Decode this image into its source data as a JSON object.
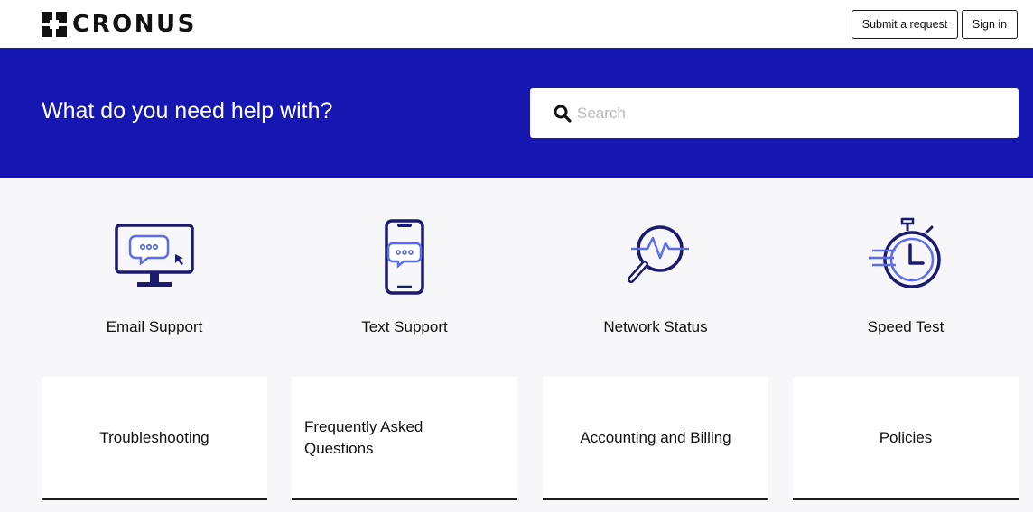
{
  "header": {
    "logo_text": "CRONUS",
    "submit_label": "Submit a request",
    "signin_label": "Sign in"
  },
  "hero": {
    "title": "What do you need help with?",
    "search_placeholder": "Search"
  },
  "tiles": [
    {
      "label": "Email Support",
      "icon": "monitor-chat-icon"
    },
    {
      "label": "Text Support",
      "icon": "phone-chat-icon"
    },
    {
      "label": "Network Status",
      "icon": "magnifier-pulse-icon"
    },
    {
      "label": "Speed Test",
      "icon": "stopwatch-icon"
    }
  ],
  "cards": [
    {
      "label": "Troubleshooting"
    },
    {
      "label": "Frequently Asked Questions"
    },
    {
      "label": "Accounting and Billing"
    },
    {
      "label": "Policies"
    }
  ],
  "colors": {
    "brand_blue": "#1617b0",
    "icon_navy": "#1a1a6e",
    "icon_accent": "#5a6cf0",
    "background": "#f7f7f9"
  }
}
